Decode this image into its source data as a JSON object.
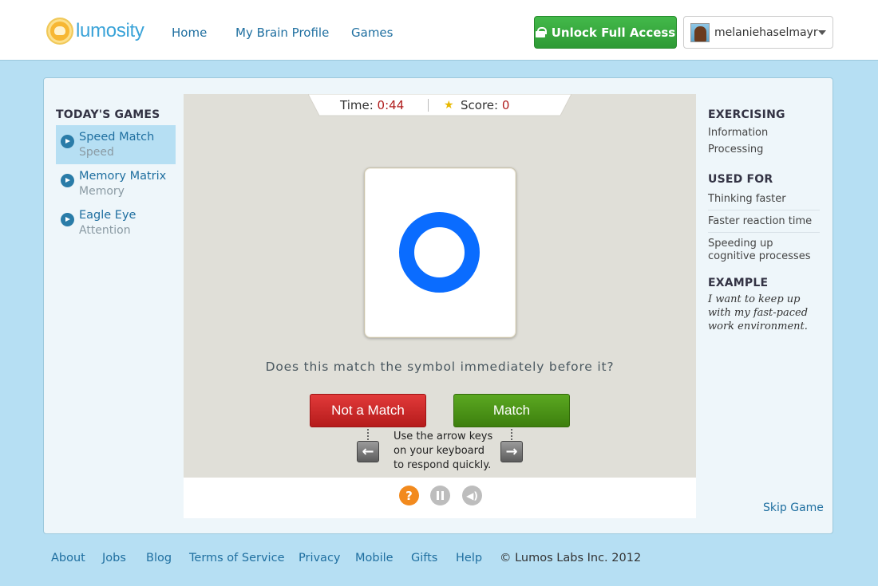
{
  "header": {
    "logo_text": "lumosity",
    "nav": [
      {
        "label": "Home"
      },
      {
        "label": "My Brain Profile"
      },
      {
        "label": "Games"
      }
    ],
    "unlock_label": "Unlock Full Access",
    "username": "melaniehaselmayr"
  },
  "todays_games": {
    "title": "TODAY'S GAMES",
    "items": [
      {
        "name": "Speed Match",
        "category": "Speed",
        "active": true
      },
      {
        "name": "Memory Matrix",
        "category": "Memory",
        "active": false
      },
      {
        "name": "Eagle Eye",
        "category": "Attention",
        "active": false
      }
    ]
  },
  "game": {
    "time_label": "Time:",
    "time_value": "0:44",
    "score_label": "Score:",
    "score_value": "0",
    "symbol": "blue-ring",
    "question": "Does this match the symbol immediately before it?",
    "not_match_label": "Not a Match",
    "match_label": "Match",
    "hint": "Use the arrow keys on your keyboard to respond quickly."
  },
  "info": {
    "exercising_title": "EXERCISING",
    "exercising_lines": [
      "Information",
      "Processing"
    ],
    "used_for_title": "USED FOR",
    "used_for": [
      "Thinking faster",
      "Faster reaction time",
      "Speeding up cognitive processes"
    ],
    "example_title": "EXAMPLE",
    "example_text": "I want to keep up with my fast-paced work environment.",
    "skip_label": "Skip Game"
  },
  "footer": {
    "links": [
      "About",
      "Jobs",
      "Blog",
      "Terms of Service",
      "Privacy",
      "Mobile",
      "Gifts",
      "Help"
    ],
    "copyright": "© Lumos Labs Inc. 2012"
  },
  "colors": {
    "page_bg": "#b6dff3",
    "link": "#1f6fa0",
    "unlock_green": "#2e9a35",
    "symbol_blue": "#0a6cff",
    "no_red": "#c62828",
    "yes_green": "#4a8f16"
  }
}
